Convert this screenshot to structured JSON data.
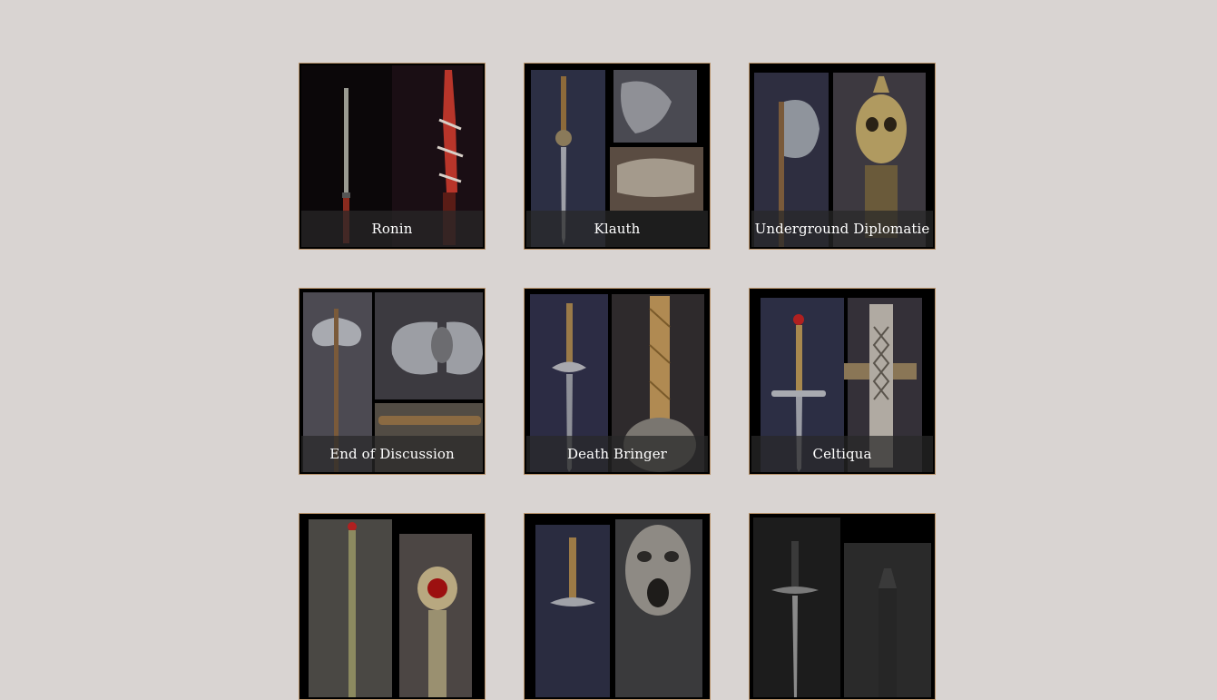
{
  "gallery": {
    "items": [
      {
        "title": "Ronin",
        "icon": "katana-photo-icon"
      },
      {
        "title": "Klauth",
        "icon": "dragon-sword-photo-icon"
      },
      {
        "title": "Underground Diplomatie",
        "icon": "skull-axe-photo-icon"
      },
      {
        "title": "End of Discussion",
        "icon": "double-axe-photo-icon"
      },
      {
        "title": "Death Bringer",
        "icon": "skull-sword-photo-icon"
      },
      {
        "title": "Celtiqua",
        "icon": "celtic-sword-photo-icon"
      },
      {
        "title": "",
        "icon": "jewel-sword-photo-icon"
      },
      {
        "title": "",
        "icon": "demon-face-sword-photo-icon"
      },
      {
        "title": "",
        "icon": "dark-sword-photo-icon"
      }
    ]
  },
  "colors": {
    "page_background": "#d9d4d2",
    "tile_border": "#b8926a",
    "caption_text": "#ffffff"
  }
}
